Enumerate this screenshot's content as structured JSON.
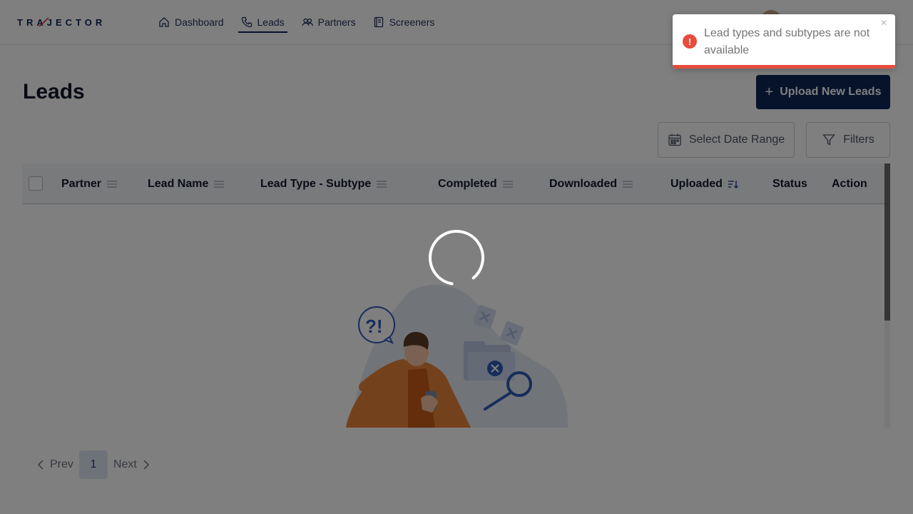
{
  "brand": {
    "logo_text": "TRAJECTOR"
  },
  "nav": {
    "items": [
      {
        "label": "Dashboard",
        "icon": "home-icon",
        "active": false
      },
      {
        "label": "Leads",
        "icon": "phone-icon",
        "active": true
      },
      {
        "label": "Partners",
        "icon": "users-icon",
        "active": false
      },
      {
        "label": "Screeners",
        "icon": "document-icon",
        "active": false
      }
    ]
  },
  "page": {
    "title": "Leads",
    "upload_label": "Upload New Leads",
    "date_range_label": "Select Date Range",
    "filters_label": "Filters"
  },
  "table": {
    "columns": [
      "Partner",
      "Lead Name",
      "Lead Type - Subtype",
      "Completed",
      "Downloaded",
      "Uploaded",
      "Status",
      "Action"
    ],
    "rows": []
  },
  "pagination": {
    "prev_label": "Prev",
    "current_page": "1",
    "next_label": "Next"
  },
  "toast": {
    "type": "error",
    "message": "Lead types and subtypes are not available",
    "progress": 1.0
  },
  "colors": {
    "brand_navy": "#0e2656",
    "error_red": "#e74c3c",
    "logo_accent": "#d93636"
  }
}
